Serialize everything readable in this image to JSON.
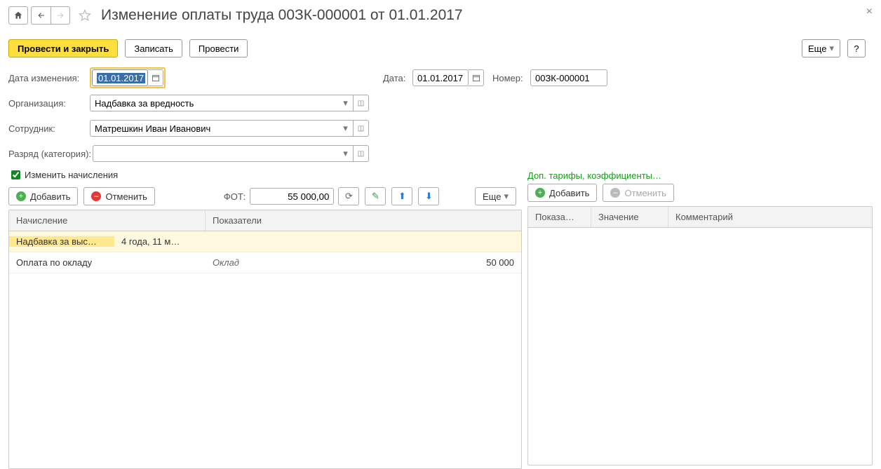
{
  "title": "Изменение оплаты труда 00ЗК-000001 от 01.01.2017",
  "cmd": {
    "post_close": "Провести и закрыть",
    "save": "Записать",
    "post": "Провести",
    "more": "Еще",
    "help": "?"
  },
  "fields": {
    "change_date_label": "Дата изменения:",
    "change_date_value": "01.01.2017",
    "date_label": "Дата:",
    "date_value": "01.01.2017",
    "number_label": "Номер:",
    "number_value": "00ЗК-000001",
    "org_label": "Организация:",
    "org_value": "Надбавка за вредность",
    "emp_label": "Сотрудник:",
    "emp_value": "Матрешкин Иван Иванович",
    "grade_label": "Разряд (категория):",
    "grade_value": "",
    "change_accruals_label": "Изменить начисления"
  },
  "left_toolbar": {
    "add": "Добавить",
    "cancel": "Отменить",
    "fot_label": "ФОТ:",
    "fot_value": "55 000,00",
    "more": "Еще"
  },
  "left_grid": {
    "headers": {
      "accrual": "Начисление",
      "indicators": "Показатели"
    },
    "rows": [
      {
        "accrual": "Надбавка за выс…",
        "period": "4 года, 11 м…",
        "indicator": "",
        "value": "",
        "highlight": true
      },
      {
        "accrual": "Оплата по окладу",
        "period": "",
        "indicator": "Оклад",
        "value": "50 000",
        "highlight": false
      }
    ]
  },
  "right_section_title": "Доп. тарифы, коэффициенты…",
  "right_toolbar": {
    "add": "Добавить",
    "cancel": "Отменить"
  },
  "right_grid": {
    "headers": {
      "indicator": "Показа…",
      "value": "Значение",
      "comment": "Комментарий"
    }
  }
}
